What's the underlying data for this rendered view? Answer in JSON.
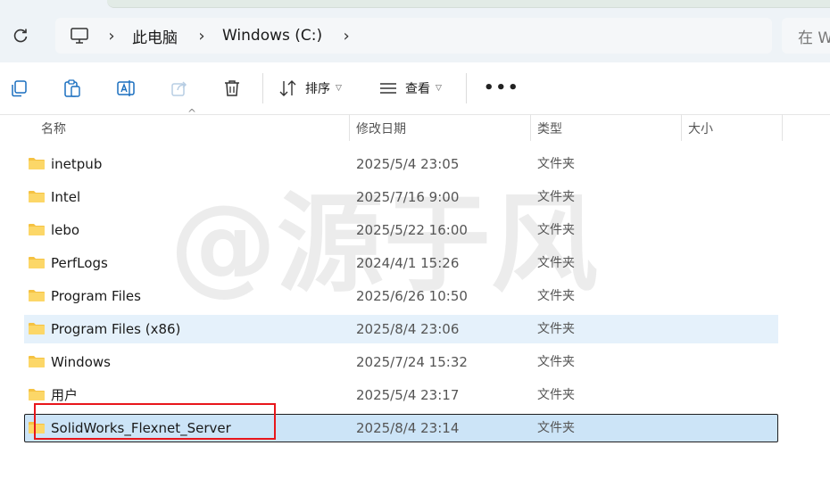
{
  "address": {
    "computer_icon": "computer-icon",
    "breadcrumb": [
      "此电脑",
      "Windows (C:)"
    ],
    "search_placeholder": "在 W"
  },
  "toolbar": {
    "sort_label": "排序",
    "view_label": "查看",
    "more_label": "•••"
  },
  "columns": {
    "name": "名称",
    "date": "修改日期",
    "type": "类型",
    "size": "大小"
  },
  "rows": [
    {
      "name": "inetpub",
      "date": "2025/5/4 23:05",
      "type": "文件夹",
      "state": "normal"
    },
    {
      "name": "Intel",
      "date": "2025/7/16 9:00",
      "type": "文件夹",
      "state": "normal"
    },
    {
      "name": "lebo",
      "date": "2025/5/22 16:00",
      "type": "文件夹",
      "state": "normal"
    },
    {
      "name": "PerfLogs",
      "date": "2024/4/1 15:26",
      "type": "文件夹",
      "state": "normal"
    },
    {
      "name": "Program Files",
      "date": "2025/6/26 10:50",
      "type": "文件夹",
      "state": "normal"
    },
    {
      "name": "Program Files (x86)",
      "date": "2025/8/4 23:06",
      "type": "文件夹",
      "state": "hover"
    },
    {
      "name": "Windows",
      "date": "2025/7/24 15:32",
      "type": "文件夹",
      "state": "normal"
    },
    {
      "name": "用户",
      "date": "2025/5/4 23:17",
      "type": "文件夹",
      "state": "normal"
    },
    {
      "name": "SolidWorks_Flexnet_Server",
      "date": "2025/8/4 23:14",
      "type": "文件夹",
      "state": "selected"
    }
  ],
  "watermark": "@源于风",
  "colors": {
    "selected": "#cce4f7",
    "hover": "#e5f1fb",
    "folder": "#f5c242",
    "annotation": "#e8161b"
  }
}
